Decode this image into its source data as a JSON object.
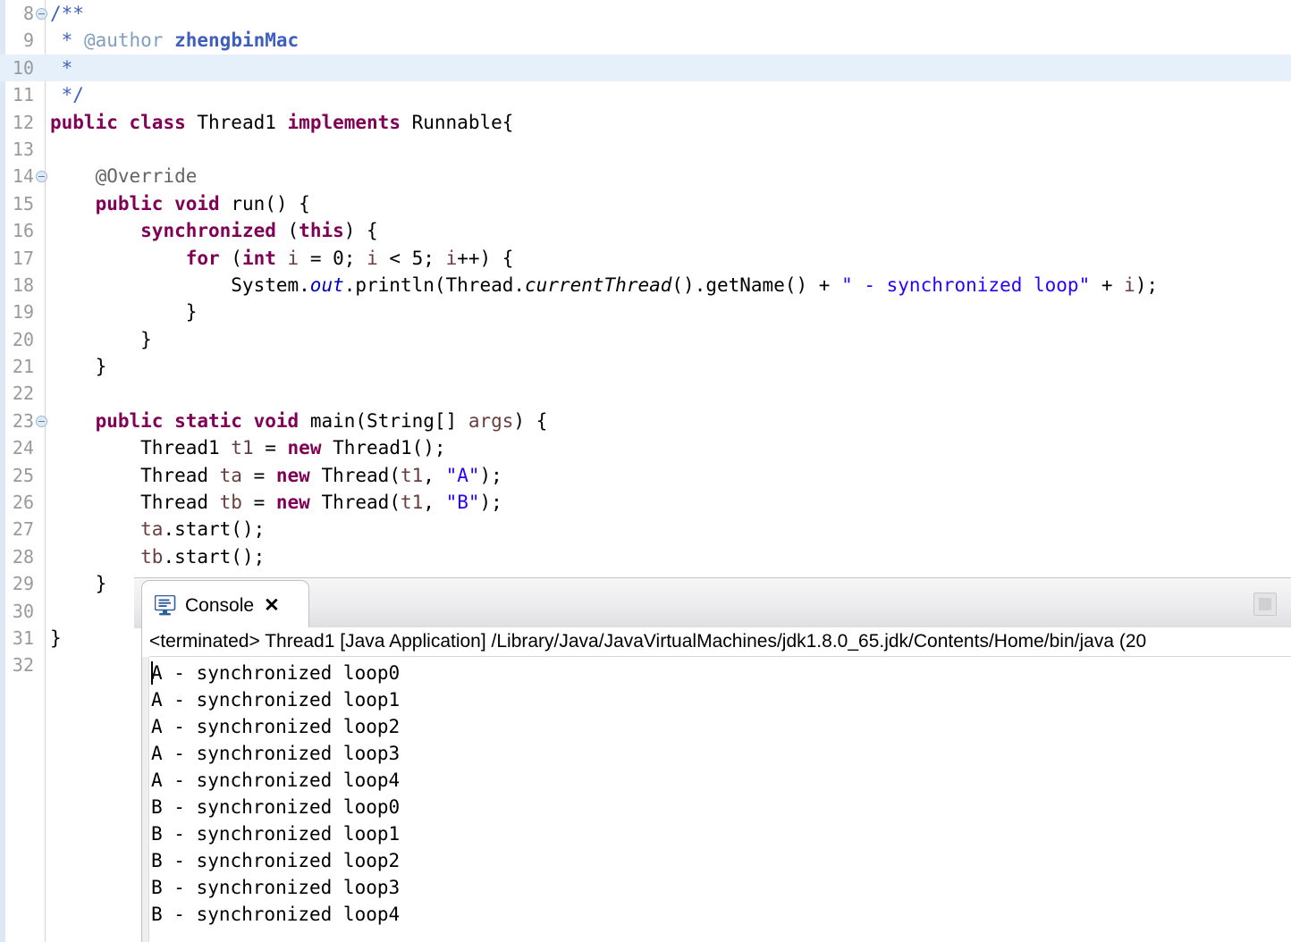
{
  "editor": {
    "name": "java-source-editor",
    "language": "Java",
    "current_line": 10,
    "colors": {
      "keyword": "#7f0055",
      "string": "#2a00ff",
      "comment": "#3f5fbf",
      "javadoc_tag": "#7f9fbf",
      "annotation": "#646464",
      "static_field": "#0000c0",
      "local_var": "#6a3e3e",
      "line_number": "#9a9a9a",
      "current_line_highlight": "#e6f0fa",
      "annotation_ruler": "#dce9f5"
    },
    "lines": [
      {
        "no": "8",
        "fold": true,
        "text": "/**"
      },
      {
        "no": "9",
        "fold": false,
        "text": " * @author zhengbinMac"
      },
      {
        "no": "10",
        "fold": false,
        "text": " *"
      },
      {
        "no": "11",
        "fold": false,
        "text": " */"
      },
      {
        "no": "12",
        "fold": false,
        "text": "public class Thread1 implements Runnable{"
      },
      {
        "no": "13",
        "fold": false,
        "text": ""
      },
      {
        "no": "14",
        "fold": true,
        "text": "    @Override"
      },
      {
        "no": "15",
        "fold": false,
        "text": "    public void run() {"
      },
      {
        "no": "16",
        "fold": false,
        "text": "        synchronized (this) {"
      },
      {
        "no": "17",
        "fold": false,
        "text": "            for (int i = 0; i < 5; i++) {"
      },
      {
        "no": "18",
        "fold": false,
        "text": "                System.out.println(Thread.currentThread().getName() + \" - synchronized loop\" + i);"
      },
      {
        "no": "19",
        "fold": false,
        "text": "            }"
      },
      {
        "no": "20",
        "fold": false,
        "text": "        }"
      },
      {
        "no": "21",
        "fold": false,
        "text": "    }"
      },
      {
        "no": "22",
        "fold": false,
        "text": ""
      },
      {
        "no": "23",
        "fold": true,
        "text": "    public static void main(String[] args) {"
      },
      {
        "no": "24",
        "fold": false,
        "text": "        Thread1 t1 = new Thread1();"
      },
      {
        "no": "25",
        "fold": false,
        "text": "        Thread ta = new Thread(t1, \"A\");"
      },
      {
        "no": "26",
        "fold": false,
        "text": "        Thread tb = new Thread(t1, \"B\");"
      },
      {
        "no": "27",
        "fold": false,
        "text": "        ta.start();"
      },
      {
        "no": "28",
        "fold": false,
        "text": "        tb.start();"
      },
      {
        "no": "29",
        "fold": false,
        "text": "    }"
      },
      {
        "no": "30",
        "fold": false,
        "text": ""
      },
      {
        "no": "31",
        "fold": false,
        "text": "}"
      },
      {
        "no": "32",
        "fold": false,
        "text": ""
      }
    ]
  },
  "console": {
    "tab_label": "Console",
    "close_glyph": "✕",
    "monitor_icon": "console-monitor-icon",
    "stop_button": "terminate-button",
    "header": "<terminated> Thread1 [Java Application] /Library/Java/JavaVirtualMachines/jdk1.8.0_65.jdk/Contents/Home/bin/java (20",
    "output": [
      "A - synchronized loop0",
      "A - synchronized loop1",
      "A - synchronized loop2",
      "A - synchronized loop3",
      "A - synchronized loop4",
      "B - synchronized loop0",
      "B - synchronized loop1",
      "B - synchronized loop2",
      "B - synchronized loop3",
      "B - synchronized loop4"
    ]
  }
}
